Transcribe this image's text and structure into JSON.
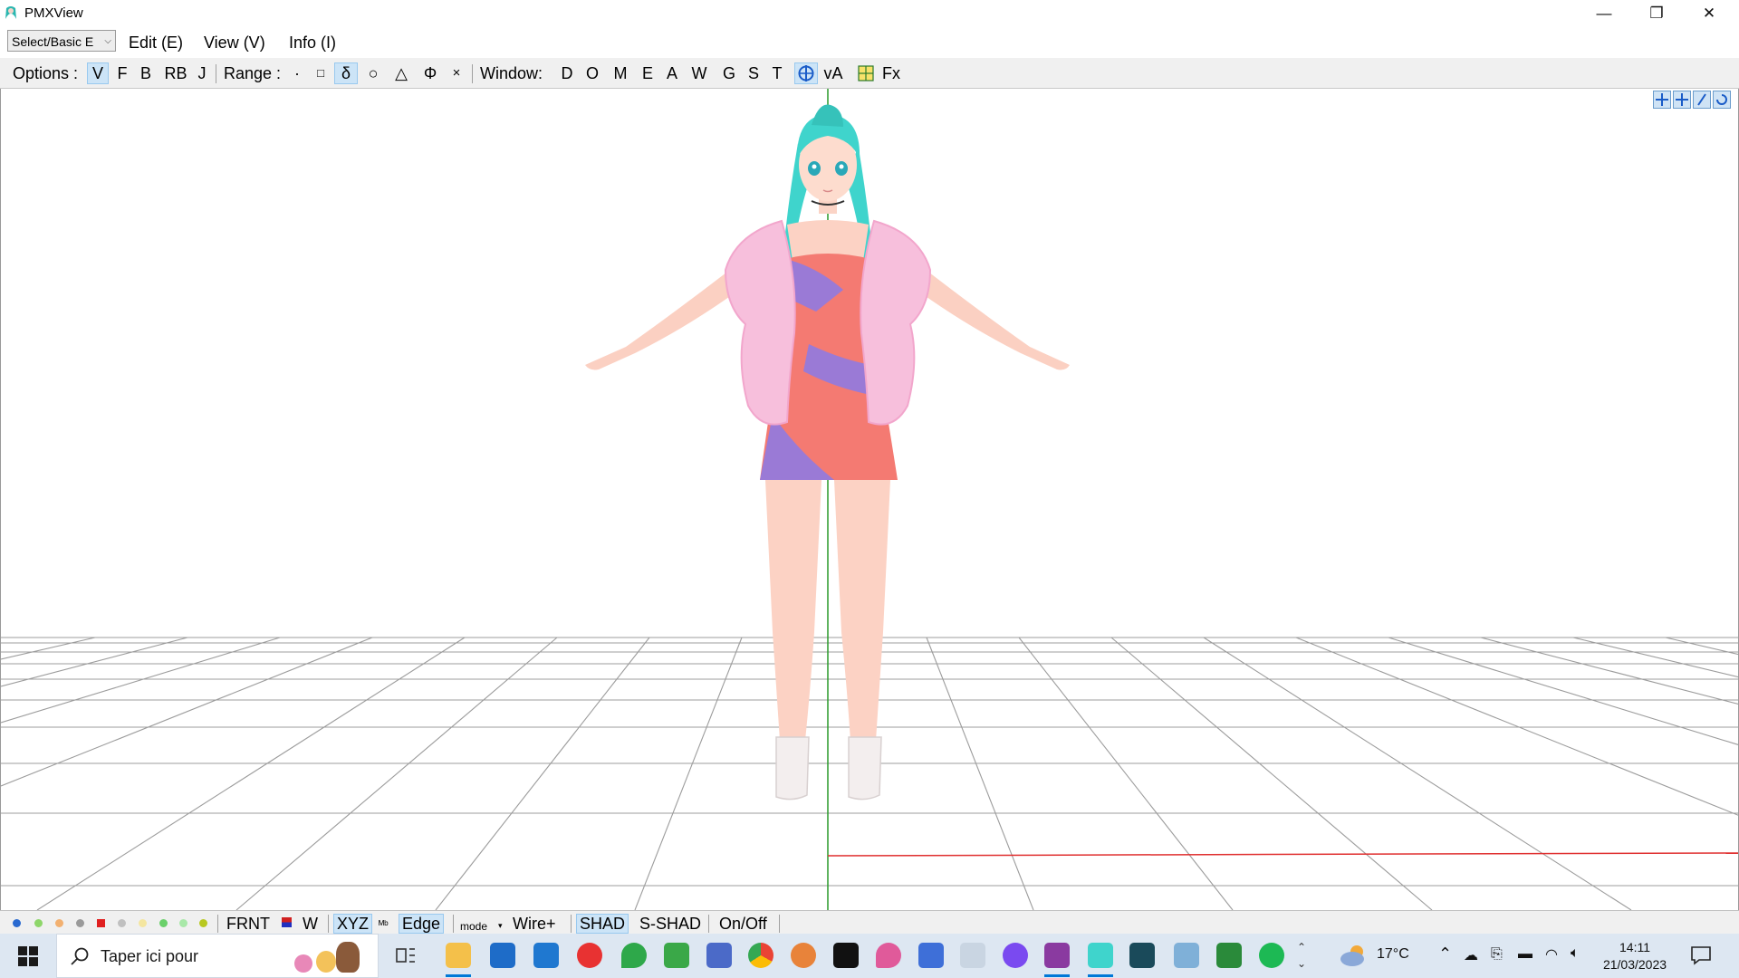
{
  "app": {
    "title": "PMXView"
  },
  "window_controls": {
    "minimize": "—",
    "restore": "❐",
    "close": "✕"
  },
  "menubar": {
    "mode_select": "Select/Basic E",
    "items": [
      "Edit (E)",
      "View (V)",
      "Info (I)"
    ]
  },
  "toolbar": {
    "options_label": "Options :",
    "options": [
      "V",
      "F",
      "B",
      "RB",
      "J"
    ],
    "range_label": "Range :",
    "range_items": [
      "·",
      "□",
      "δ",
      "○",
      "△",
      "Φ",
      "×"
    ],
    "window_label": "Window:",
    "window_items": [
      "D",
      "O",
      "M",
      "E",
      "A",
      "W",
      "G",
      "S",
      "T"
    ],
    "va_label": "vA",
    "fx_label": "Fx"
  },
  "statusbar": {
    "frnt": "FRNT",
    "w": "W",
    "xyz": "XYZ",
    "edge": "Edge",
    "mode": "mode",
    "wire": "Wire+",
    "shad": "SHAD",
    "sshad": "S-SHAD",
    "onoff": "On/Off"
  },
  "taskbar": {
    "search_placeholder": "Taper ici pour",
    "temperature": "17°C",
    "time": "14:11",
    "date": "21/03/2023"
  },
  "colors": {
    "accent": "#0078d7",
    "active_button": "#cce4f7",
    "grid": "#9c9c9c",
    "axis_y": "#2a9a2a",
    "axis_x": "#e03030",
    "hair": "#3fd4cc",
    "dress_coral": "#f47a72",
    "dress_purple": "#9a7ad6",
    "fur": "#f7bfdc",
    "skin": "#fcd2c4"
  }
}
